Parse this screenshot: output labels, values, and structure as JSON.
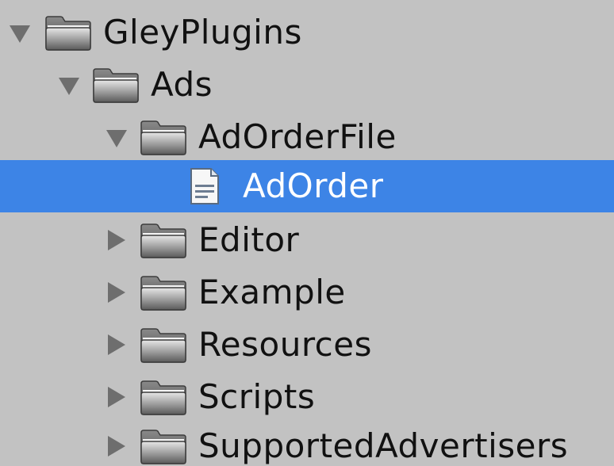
{
  "colors": {
    "background": "#c2c2c2",
    "selection": "#3d84e6",
    "text": "#111111",
    "selected_text": "#ffffff",
    "arrow": "#6e6e6e"
  },
  "tree": {
    "items": [
      {
        "label": "GleyPlugins",
        "icon": "folder-icon",
        "expanded": true
      },
      {
        "label": "Ads",
        "icon": "folder-icon",
        "expanded": true
      },
      {
        "label": "AdOrderFile",
        "icon": "folder-icon",
        "expanded": true
      },
      {
        "label": "AdOrder",
        "icon": "text-file-icon",
        "selected": true
      },
      {
        "label": "Editor",
        "icon": "folder-icon",
        "expanded": false
      },
      {
        "label": "Example",
        "icon": "folder-icon",
        "expanded": false
      },
      {
        "label": "Resources",
        "icon": "folder-icon",
        "expanded": false
      },
      {
        "label": "Scripts",
        "icon": "folder-icon",
        "expanded": false
      },
      {
        "label": "SupportedAdvertisers",
        "icon": "folder-icon",
        "expanded": false
      }
    ]
  }
}
